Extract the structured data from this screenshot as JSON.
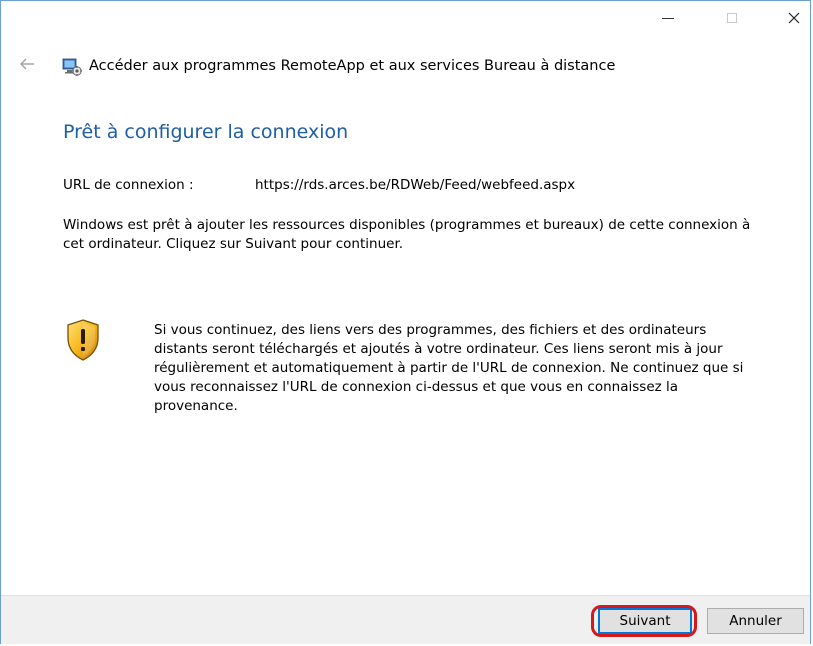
{
  "window": {
    "header_title": "Accéder aux programmes RemoteApp et aux services Bureau à distance",
    "controls": {
      "minimize": "—",
      "maximize": "☐",
      "close": "✕"
    }
  },
  "page": {
    "heading": "Prêt à configurer la connexion",
    "url_label": "URL de connexion :",
    "url_value": "https://rds.arces.be/RDWeb/Feed/webfeed.aspx",
    "intro_text": "Windows est prêt à ajouter les ressources disponibles (programmes et bureaux) de cette connexion à cet ordinateur. Cliquez sur Suivant pour continuer.",
    "warning_text": "Si vous continuez, des liens vers des programmes, des fichiers et des ordinateurs distants seront téléchargés et ajoutés à votre ordinateur. Ces liens seront mis à jour régulièrement et automatiquement à partir de l'URL de connexion. Ne continuez que si vous reconnaissez l'URL de connexion ci-dessus et que vous en connaissez la provenance."
  },
  "footer": {
    "next_label": "Suivant",
    "cancel_label": "Annuler"
  },
  "icons": {
    "back": "back-arrow-icon",
    "app": "remoteapp-icon",
    "warning": "shield-warning-icon"
  },
  "colors": {
    "heading": "#1e5ea5",
    "highlight": "#d6171c",
    "window_border": "#6a9fd4",
    "footer_bg": "#f0f0f0"
  }
}
